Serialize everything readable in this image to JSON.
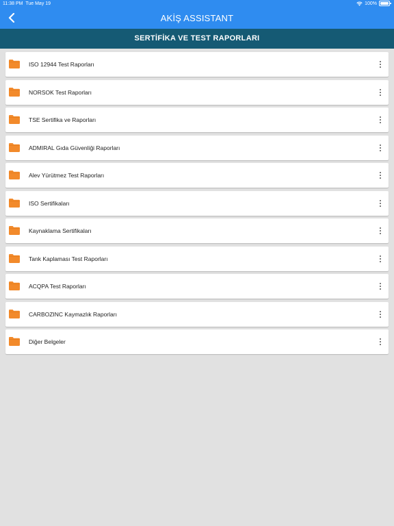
{
  "status_bar": {
    "time": "11:38 PM",
    "date": "Tue May 19",
    "battery": "100%"
  },
  "header": {
    "title": "AKİŞ ASSISTANT"
  },
  "subheader": {
    "title": "SERTİFİKA VE TEST RAPORLARI"
  },
  "colors": {
    "header": "#2f8cf0",
    "subheader": "#155a74",
    "folder": "#f28a2b",
    "background": "#e1e1e1"
  },
  "folders": [
    {
      "label": "ISO 12944 Test Raporları"
    },
    {
      "label": "NORSOK Test Raporları"
    },
    {
      "label": "TSE Sertifika ve Raporları"
    },
    {
      "label": "ADMIRAL Gıda Güvenliği Raporları"
    },
    {
      "label": "Alev Yürütmez Test Raporları"
    },
    {
      "label": "ISO Sertifikaları"
    },
    {
      "label": "Kaynaklama Sertifikaları"
    },
    {
      "label": "Tank Kaplaması Test Raporları"
    },
    {
      "label": "ACQPA Test Raporları"
    },
    {
      "label": "CARBOZINC Kaymazlık Raporları"
    },
    {
      "label": "Diğer Belgeler"
    }
  ]
}
